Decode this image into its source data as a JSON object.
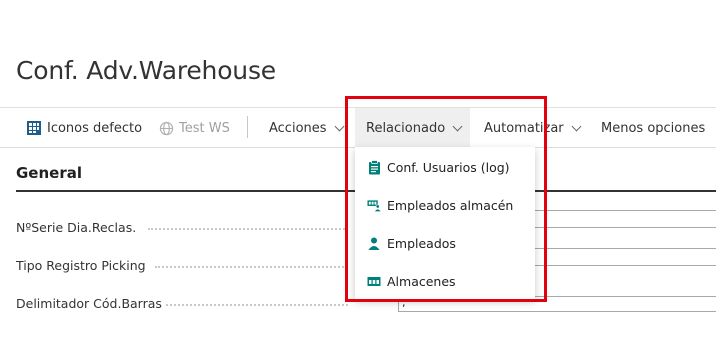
{
  "page": {
    "title": "Conf. Adv.Warehouse"
  },
  "actionbar": {
    "items": [
      {
        "label": "Iconos defecto",
        "icon": "grid-icon"
      },
      {
        "label": "Test WS",
        "icon": "globe-icon",
        "disabled": true
      },
      {
        "label": "Acciones",
        "chevron": true
      },
      {
        "label": "Relacionado",
        "chevron": true,
        "active": true
      },
      {
        "label": "Automatizar",
        "chevron": true
      },
      {
        "label": "Menos opciones"
      }
    ]
  },
  "section": {
    "title": "General"
  },
  "fields": [
    {
      "label": "NºSerie Dia.Reclas."
    },
    {
      "label": "Tipo Registro Picking"
    },
    {
      "label": "Delimitador Cód.Barras",
      "value": ","
    }
  ],
  "dropdown": {
    "items": [
      {
        "label": "Conf. Usuarios (log)",
        "icon": "clipboard-icon"
      },
      {
        "label": "Empleados almacén",
        "icon": "employee-warehouse-icon"
      },
      {
        "label": "Empleados",
        "icon": "person-icon"
      },
      {
        "label": "Almacenes",
        "icon": "warehouse-icon"
      }
    ]
  },
  "colors": {
    "accent": "#00807a",
    "highlight": "#e3000f",
    "icon_blue": "#1b5e8c"
  }
}
